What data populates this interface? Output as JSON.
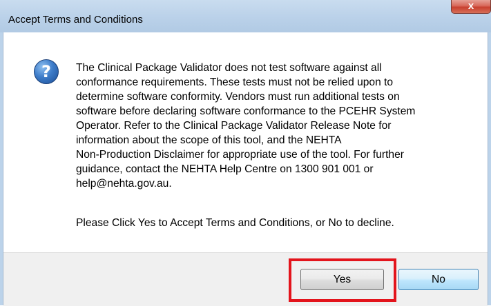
{
  "window": {
    "title": "Accept Terms and Conditions",
    "close_glyph": "x"
  },
  "icon": {
    "name": "question-icon",
    "glyph": "?"
  },
  "message": {
    "lines": [
      "The Clinical Package Validator does not test software against all",
      "conformance requirements. These tests must not be relied upon to",
      "determine software conformity. Vendors must run additional tests on",
      "software before declaring software conformance to the PCEHR System",
      "Operator. Refer to the Clinical Package Validator Release Note for",
      "information about the scope of this tool, and the NEHTA",
      "Non-Production Disclaimer for appropriate use of the tool. For further",
      "guidance, contact the NEHTA Help Centre on 1300 901 001 or",
      "help@nehta.gov.au."
    ],
    "prompt": "Please Click Yes to Accept Terms and Conditions, or No to decline."
  },
  "buttons": {
    "yes_label": "Yes",
    "no_label": "No"
  },
  "colors": {
    "highlight": "#e3141c",
    "titlebar": "#bad1e9"
  }
}
